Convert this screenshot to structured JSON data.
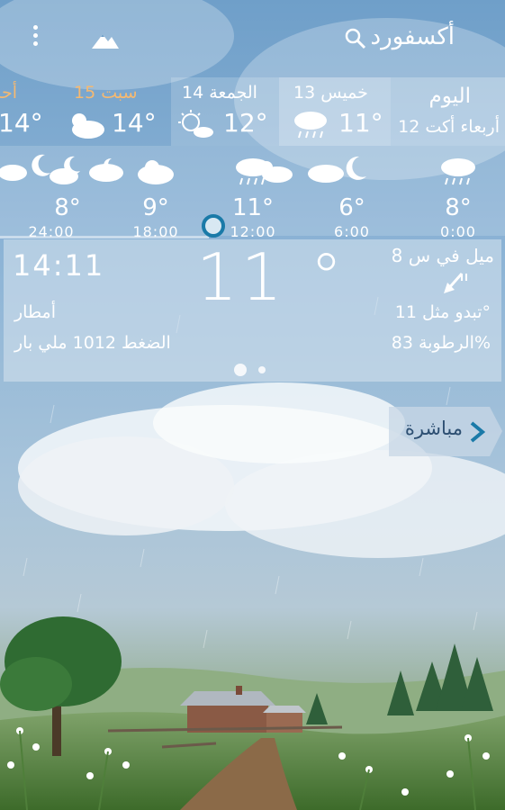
{
  "header": {
    "city": "أكسفورد"
  },
  "days": [
    {
      "name": "أحد",
      "temp": "14°",
      "icon": "cloud-moon-icon",
      "color": "#f5b971"
    },
    {
      "name": "سبت 15",
      "temp": "14°",
      "icon": "sun-cloud-icon",
      "color": "#f5b971"
    },
    {
      "name": "الجمعة 14",
      "temp": "12°",
      "icon": "sun-cloud-icon",
      "color": "#ffffff"
    },
    {
      "name": "خميس 13",
      "temp": "11°",
      "icon": "rain-icon",
      "color": "#ffffff",
      "selected": true
    }
  ],
  "today": {
    "label": "اليوم",
    "sub": "أربعاء أكت 12"
  },
  "hourly": [
    {
      "time": "24:00",
      "temp": "8°",
      "icon": "cloud-moon-icon"
    },
    {
      "time": "18:00",
      "temp": "9°",
      "icon": "cloud-icon"
    },
    {
      "time": "12:00",
      "temp": "11°",
      "icon": "rain-icon"
    },
    {
      "time": "6:00",
      "temp": "6°",
      "icon": "moon-icon"
    },
    {
      "time": "0:00",
      "temp": "8°",
      "icon": "rain-icon"
    }
  ],
  "current": {
    "time": "14:11",
    "temp": "11 °",
    "wind": "8 ميل في س",
    "condition": "أمطار",
    "feels_like": "تبدو مثل 11°",
    "pressure": "الضغط 1012 ملي بار",
    "humidity": "الرطوبة 83%"
  },
  "live_button": {
    "label": "مباشرة"
  },
  "colors": {
    "accent": "#1a7aa8",
    "weekend": "#f5b971",
    "live_text": "#2d4f72"
  }
}
